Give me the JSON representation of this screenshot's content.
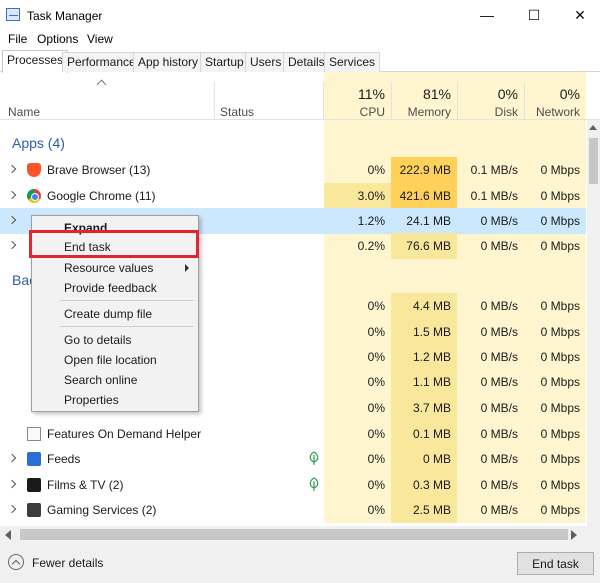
{
  "window": {
    "title": "Task Manager",
    "minimize_glyph": "—",
    "maximize_glyph": "☐",
    "close_glyph": "✕"
  },
  "menu": [
    "File",
    "Options",
    "View"
  ],
  "tabs": [
    "Processes",
    "Performance",
    "App history",
    "Startup",
    "Users",
    "Details",
    "Services"
  ],
  "active_tab": "Processes",
  "columns": {
    "name": "Name",
    "status": "Status",
    "cpu": {
      "percent": "11%",
      "label": "CPU"
    },
    "memory": {
      "percent": "81%",
      "label": "Memory"
    },
    "disk": {
      "percent": "0%",
      "label": "Disk"
    },
    "network": {
      "percent": "0%",
      "label": "Network"
    }
  },
  "groups": {
    "apps": "Apps (4)",
    "background": "Bac"
  },
  "rows": [
    {
      "name": "Brave Browser (13)",
      "cpu": "0%",
      "mem": "222.9 MB",
      "disk": "0.1 MB/s",
      "net": "0 Mbps"
    },
    {
      "name": "Google Chrome (11)",
      "cpu": "3.0%",
      "mem": "421.6 MB",
      "disk": "0.1 MB/s",
      "net": "0 Mbps"
    },
    {
      "name": "",
      "cpu": "1.2%",
      "mem": "24.1 MB",
      "disk": "0 MB/s",
      "net": "0 Mbps"
    },
    {
      "name": "",
      "cpu": "0.2%",
      "mem": "76.6 MB",
      "disk": "0 MB/s",
      "net": "0 Mbps"
    },
    {
      "name": "",
      "cpu": "0%",
      "mem": "4.4 MB",
      "disk": "0 MB/s",
      "net": "0 Mbps"
    },
    {
      "name": "",
      "cpu": "0%",
      "mem": "1.5 MB",
      "disk": "0 MB/s",
      "net": "0 Mbps"
    },
    {
      "name": "",
      "cpu": "0%",
      "mem": "1.2 MB",
      "disk": "0 MB/s",
      "net": "0 Mbps"
    },
    {
      "name": "",
      "cpu": "0%",
      "mem": "1.1 MB",
      "disk": "0 MB/s",
      "net": "0 Mbps"
    },
    {
      "name": "",
      "cpu": "0%",
      "mem": "3.7 MB",
      "disk": "0 MB/s",
      "net": "0 Mbps"
    },
    {
      "name": "Features On Demand Helper",
      "cpu": "0%",
      "mem": "0.1 MB",
      "disk": "0 MB/s",
      "net": "0 Mbps"
    },
    {
      "name": "Feeds",
      "cpu": "0%",
      "mem": "0 MB",
      "disk": "0 MB/s",
      "net": "0 Mbps"
    },
    {
      "name": "Films & TV (2)",
      "cpu": "0%",
      "mem": "0.3 MB",
      "disk": "0 MB/s",
      "net": "0 Mbps"
    },
    {
      "name": "Gaming Services (2)",
      "cpu": "0%",
      "mem": "2.5 MB",
      "disk": "0 MB/s",
      "net": "0 Mbps"
    }
  ],
  "context_menu": {
    "expand": "Expand",
    "end_task": "End task",
    "resource_values": "Resource values",
    "provide_feedback": "Provide feedback",
    "create_dump_file": "Create dump file",
    "go_to_details": "Go to details",
    "open_file_location": "Open file location",
    "search_online": "Search online",
    "properties": "Properties"
  },
  "footer": {
    "fewer_details": "Fewer details",
    "end_task_button": "End task"
  },
  "colors": {
    "selection": "#cce8ff",
    "highlight_box": "#e0262e",
    "memory_heat": "#ffd15a",
    "column_shade": "#fff6cf",
    "group_label": "#2d5da8"
  }
}
